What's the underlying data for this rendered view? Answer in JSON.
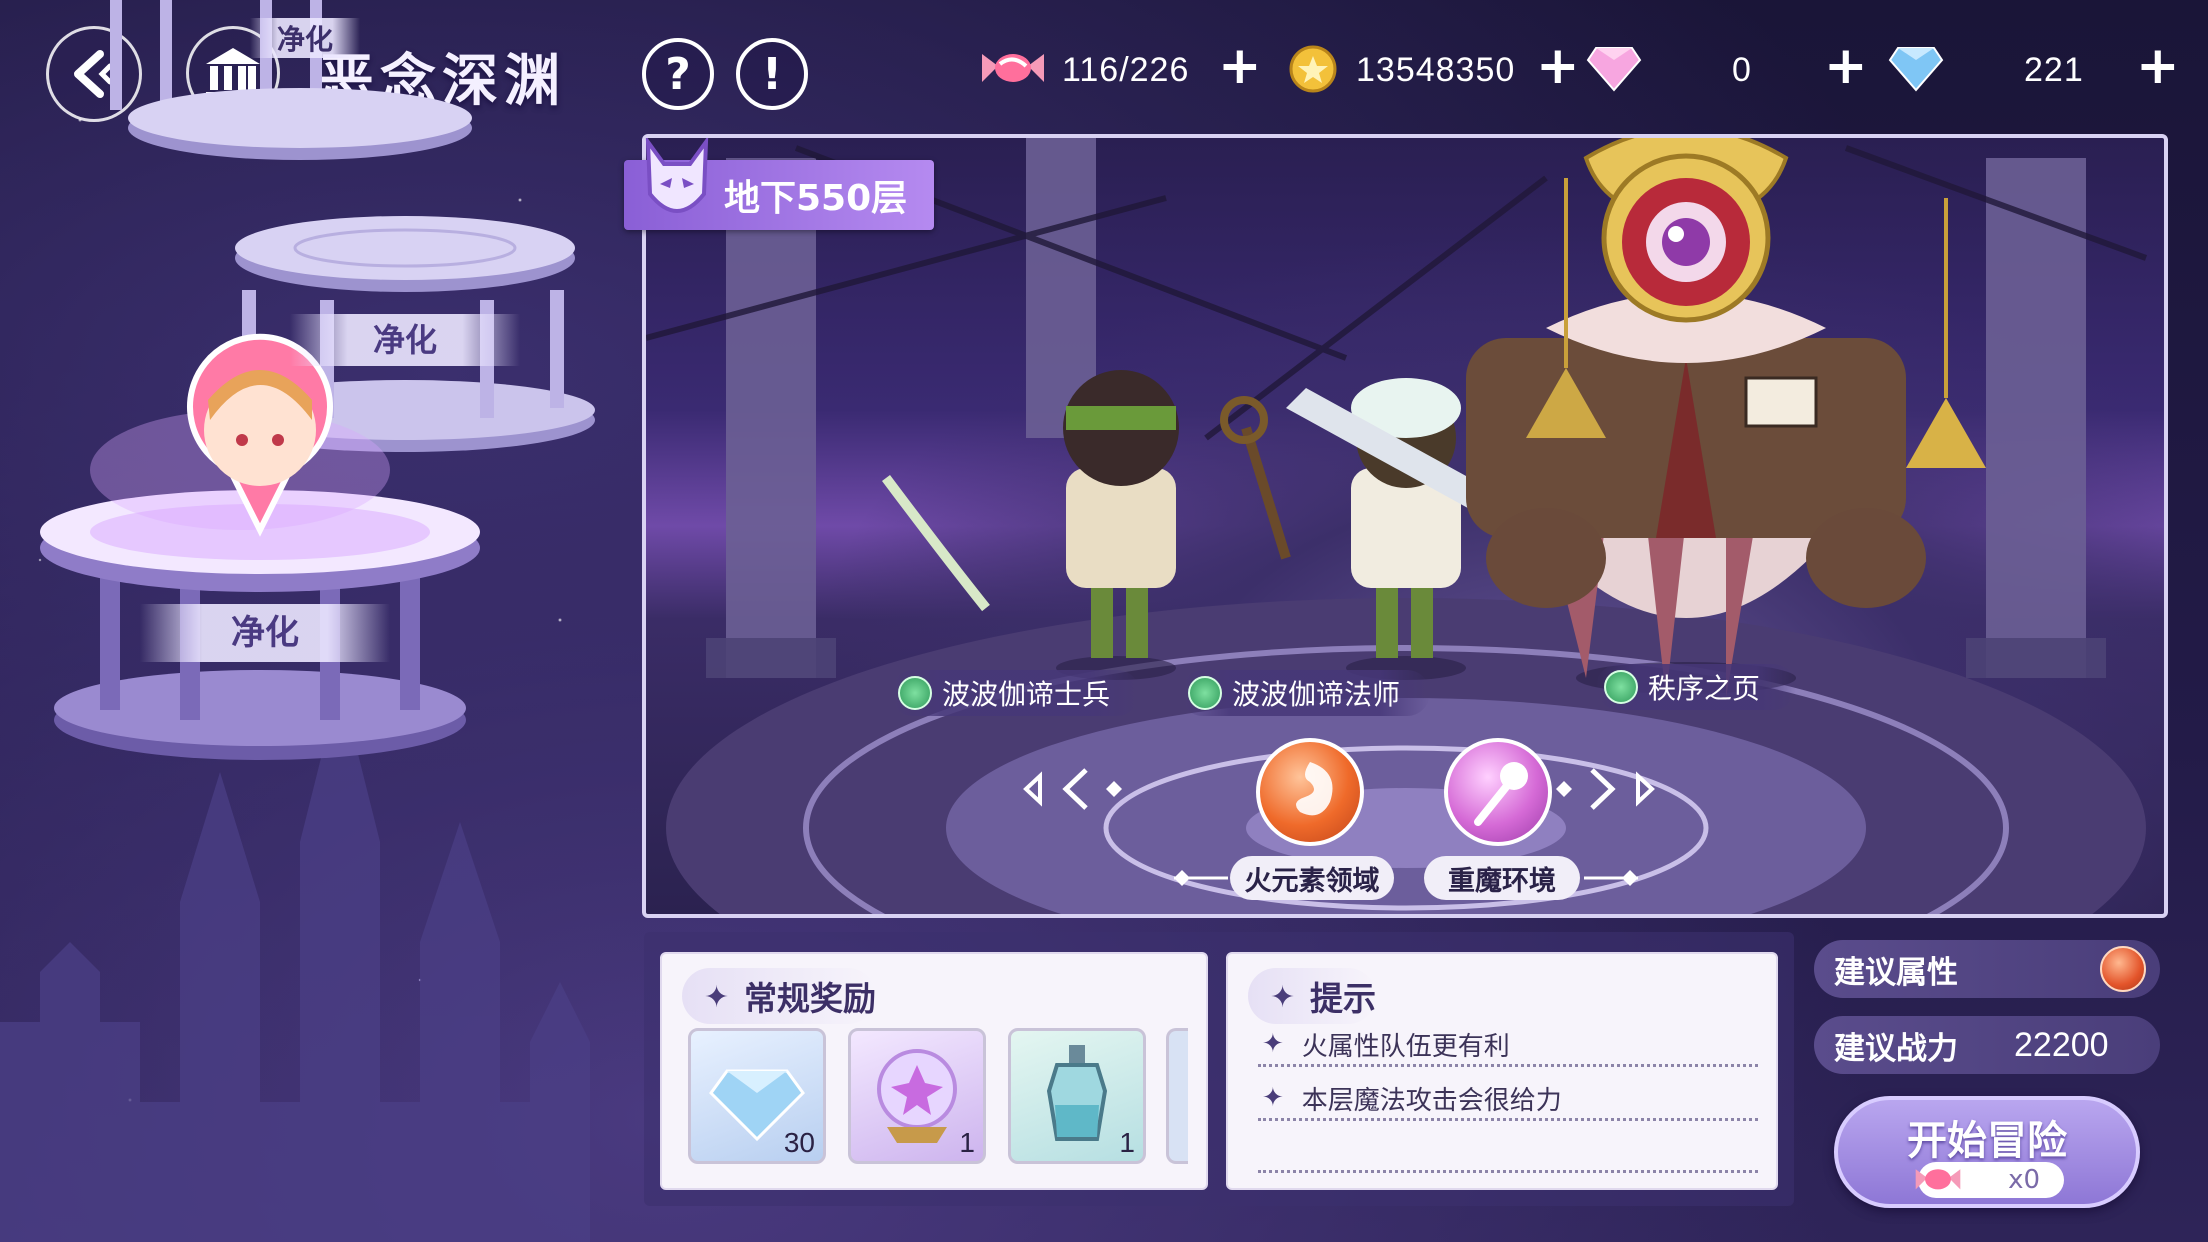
{
  "header": {
    "title": "恶念深渊",
    "help_symbol": "?",
    "info_symbol": "!",
    "back_icon": "back-arrow-icon",
    "mode_icon": "temple-icon"
  },
  "resources": {
    "stamina": {
      "value": "116/226",
      "icon": "candy-icon"
    },
    "gold": {
      "value": "13548350",
      "icon": "gold-coin-icon"
    },
    "pink_gem": {
      "value": "0",
      "icon": "pink-diamond-icon"
    },
    "blue_gem": {
      "value": "221",
      "icon": "blue-diamond-icon"
    },
    "plus": "+"
  },
  "tower": {
    "platform_top_label": "净化",
    "platform_mid_label": "净化",
    "platform_current_label": "净化"
  },
  "stage": {
    "floor": "地下550层",
    "enemies": [
      {
        "name": "波波伽谛士兵"
      },
      {
        "name": "波波伽谛法师"
      },
      {
        "name": "秩序之页"
      }
    ],
    "environments": [
      {
        "label": "火元素领域",
        "color": "#ef6a2a"
      },
      {
        "label": "重魔环境",
        "color": "#d56ad6"
      }
    ]
  },
  "rewards": {
    "title": "常规奖励",
    "items": [
      {
        "name": "diamond-icon",
        "count": "30"
      },
      {
        "name": "magic-orb-icon",
        "count": "1"
      },
      {
        "name": "potion-bottle-icon",
        "count": "1"
      }
    ]
  },
  "tips": {
    "title": "提示",
    "lines": [
      "火属性队伍更有利",
      "本层魔法攻击会很给力"
    ]
  },
  "recommend": {
    "attribute_label": "建议属性",
    "power_label": "建议战力",
    "power_value": "22200"
  },
  "start": {
    "label": "开始冒险",
    "cost": "x0"
  },
  "colors": {
    "accent": "#8e77d6",
    "fire": "#ef6a2a"
  }
}
